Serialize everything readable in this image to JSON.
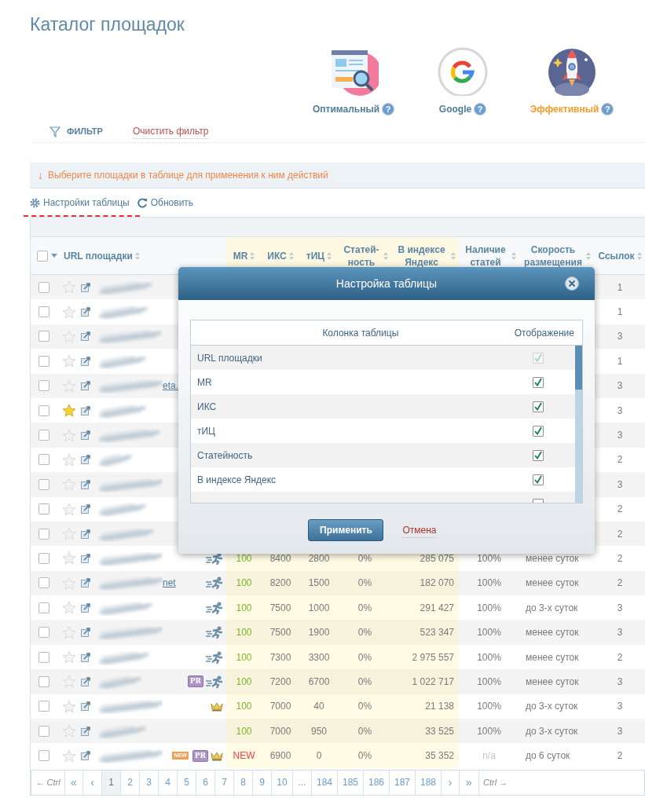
{
  "page": {
    "title": "Каталог площадок"
  },
  "presets": [
    {
      "kind": "optimal",
      "label": "Оптимальный",
      "help": "?",
      "selected": false
    },
    {
      "kind": "google",
      "label": "Google",
      "help": "?",
      "selected": false
    },
    {
      "kind": "effective",
      "label": "Эффективный",
      "help": "?",
      "selected": true
    }
  ],
  "filter": {
    "button": "ФИЛЬТР",
    "clear": "Очистить фильтр"
  },
  "notice": {
    "arrow": "↓",
    "text": "Выберите площадки в таблице для применения к ним действий"
  },
  "table_actions": [
    {
      "kind": "settings",
      "label": "Настройки таблицы"
    },
    {
      "kind": "refresh",
      "label": "Обновить"
    }
  ],
  "table": {
    "select_all": {
      "checked": false
    },
    "columns": [
      {
        "label": "URL площадки",
        "highlighted": false
      },
      {
        "label": "MR",
        "highlighted": true
      },
      {
        "label": "ИКС",
        "highlighted": true
      },
      {
        "label": "тИЦ",
        "highlighted": true
      },
      {
        "label": "Статей-ность",
        "highlighted": true
      },
      {
        "label": "В индексе Яндекс",
        "highlighted": true
      },
      {
        "label": "Наличие статей",
        "highlighted": false
      },
      {
        "label": "Скорость размещения",
        "highlighted": false
      },
      {
        "label": "Ссылок",
        "highlighted": false
      }
    ],
    "rows": [
      {
        "checked": false,
        "starred": false,
        "links": "1"
      },
      {
        "checked": false,
        "starred": false,
        "links": "1"
      },
      {
        "checked": false,
        "starred": false,
        "links": "3"
      },
      {
        "checked": false,
        "starred": false,
        "links": "1"
      },
      {
        "checked": false,
        "starred": false,
        "url_visible": "eta.",
        "links": "3"
      },
      {
        "checked": false,
        "starred": true,
        "links": "3"
      },
      {
        "checked": false,
        "starred": false,
        "links": "3"
      },
      {
        "checked": false,
        "starred": false,
        "links": "2"
      },
      {
        "checked": false,
        "starred": false,
        "links": "3"
      },
      {
        "checked": false,
        "starred": false,
        "links": "2"
      },
      {
        "checked": false,
        "starred": false,
        "links": "2"
      },
      {
        "checked": false,
        "starred": false,
        "badges": [
          {
            "kind": "runner"
          }
        ],
        "mr": "100",
        "mr_is_new": false,
        "iks": "8400",
        "tic": "2800",
        "articles": "0%",
        "yandex_index": "285 075",
        "availability": "100%",
        "availability_na": false,
        "speed": "менее суток",
        "links": "2"
      },
      {
        "checked": false,
        "starred": false,
        "url_visible": "net",
        "badges": [
          {
            "kind": "runner"
          }
        ],
        "mr": "100",
        "mr_is_new": false,
        "iks": "8200",
        "tic": "1500",
        "articles": "0%",
        "yandex_index": "182 070",
        "availability": "100%",
        "availability_na": false,
        "speed": "менее суток",
        "links": "2"
      },
      {
        "checked": false,
        "starred": false,
        "badges": [
          {
            "kind": "runner"
          }
        ],
        "mr": "100",
        "mr_is_new": false,
        "iks": "7500",
        "tic": "1000",
        "articles": "0%",
        "yandex_index": "291 427",
        "availability": "100%",
        "availability_na": false,
        "speed": "до 3-х суток",
        "links": "3"
      },
      {
        "checked": false,
        "starred": false,
        "badges": [
          {
            "kind": "runner"
          }
        ],
        "mr": "100",
        "mr_is_new": false,
        "iks": "7500",
        "tic": "1900",
        "articles": "0%",
        "yandex_index": "523 347",
        "availability": "100%",
        "availability_na": false,
        "speed": "менее суток",
        "links": "3"
      },
      {
        "checked": false,
        "starred": false,
        "badges": [
          {
            "kind": "runner"
          }
        ],
        "mr": "100",
        "mr_is_new": false,
        "iks": "7300",
        "tic": "3300",
        "articles": "0%",
        "yandex_index": "2 975 557",
        "availability": "100%",
        "availability_na": false,
        "speed": "менее суток",
        "links": "2"
      },
      {
        "checked": false,
        "starred": false,
        "badges": [
          {
            "kind": "pr",
            "text": "PR"
          },
          {
            "kind": "runner"
          }
        ],
        "mr": "100",
        "mr_is_new": false,
        "iks": "7200",
        "tic": "6700",
        "articles": "0%",
        "yandex_index": "1 022 717",
        "availability": "100%",
        "availability_na": false,
        "speed": "менее суток",
        "links": "3"
      },
      {
        "checked": false,
        "starred": false,
        "badges": [
          {
            "kind": "crown"
          }
        ],
        "mr": "100",
        "mr_is_new": false,
        "iks": "7000",
        "tic": "40",
        "articles": "0%",
        "yandex_index": "21 138",
        "availability": "100%",
        "availability_na": false,
        "speed": "до 3-х суток",
        "links": "3"
      },
      {
        "checked": false,
        "starred": false,
        "mr": "100",
        "mr_is_new": false,
        "iks": "7000",
        "tic": "950",
        "articles": "0%",
        "yandex_index": "33 525",
        "availability": "100%",
        "availability_na": false,
        "speed": "до 3-х суток",
        "links": "3"
      },
      {
        "checked": false,
        "starred": false,
        "badges": [
          {
            "kind": "new",
            "text": "NEW"
          },
          {
            "kind": "pr",
            "text": "PR"
          },
          {
            "kind": "crown"
          }
        ],
        "mr": "NEW",
        "mr_is_new": true,
        "iks": "6900",
        "tic": "0",
        "articles": "0%",
        "yandex_index": "35 352",
        "availability": "n/a",
        "availability_na": true,
        "speed": "до 6 суток",
        "links": "2"
      }
    ]
  },
  "pagination": {
    "prev_hint": "← Ctrl",
    "first": "«",
    "prev": "‹",
    "next": "›",
    "last": "»",
    "next_hint": "Ctrl →",
    "pages": [
      {
        "label": "1",
        "selected": true
      },
      {
        "label": "2",
        "selected": false
      },
      {
        "label": "3",
        "selected": false
      },
      {
        "label": "4",
        "selected": false
      },
      {
        "label": "5",
        "selected": false
      },
      {
        "label": "6",
        "selected": false
      },
      {
        "label": "7",
        "selected": false
      },
      {
        "label": "8",
        "selected": false
      },
      {
        "label": "9",
        "selected": false
      },
      {
        "label": "10",
        "selected": false
      },
      {
        "label": "...",
        "selected": false
      },
      {
        "label": "184",
        "selected": false
      },
      {
        "label": "185",
        "selected": false
      },
      {
        "label": "186",
        "selected": false
      },
      {
        "label": "187",
        "selected": false
      },
      {
        "label": "188",
        "selected": false
      }
    ]
  },
  "dialog": {
    "title": "Настройка таблицы",
    "column_header": "Колонка таблицы",
    "display_header": "Отображение",
    "items": [
      {
        "label": "URL площадки",
        "checked": true,
        "disabled": true
      },
      {
        "label": "MR",
        "checked": true,
        "disabled": false
      },
      {
        "label": "ИКС",
        "checked": true,
        "disabled": false
      },
      {
        "label": "тИЦ",
        "checked": true,
        "disabled": false
      },
      {
        "label": "Статейность",
        "checked": true,
        "disabled": false
      },
      {
        "label": "В индексе Яндекс",
        "checked": true,
        "disabled": false
      },
      {
        "checked": false,
        "disabled": false
      }
    ],
    "apply": "Применить",
    "cancel": "Отмена"
  }
}
